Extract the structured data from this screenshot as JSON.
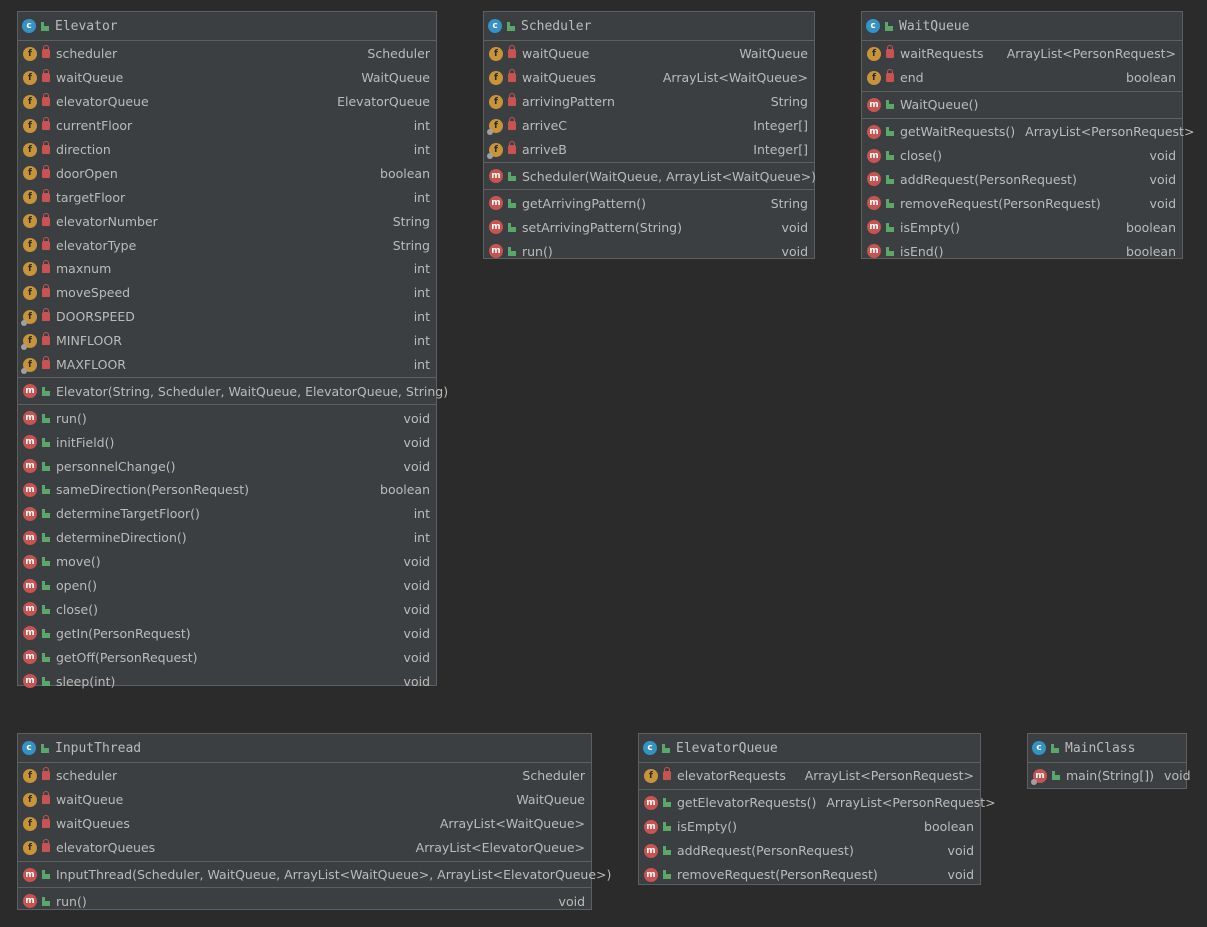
{
  "classes": {
    "elevator": {
      "name": "Elevator",
      "fields": [
        {
          "name": "scheduler",
          "type": "Scheduler",
          "static": false
        },
        {
          "name": "waitQueue",
          "type": "WaitQueue",
          "static": false
        },
        {
          "name": "elevatorQueue",
          "type": "ElevatorQueue",
          "static": false
        },
        {
          "name": "currentFloor",
          "type": "int",
          "static": false
        },
        {
          "name": "direction",
          "type": "int",
          "static": false
        },
        {
          "name": "doorOpen",
          "type": "boolean",
          "static": false
        },
        {
          "name": "targetFloor",
          "type": "int",
          "static": false
        },
        {
          "name": "elevatorNumber",
          "type": "String",
          "static": false
        },
        {
          "name": "elevatorType",
          "type": "String",
          "static": false
        },
        {
          "name": "maxnum",
          "type": "int",
          "static": false
        },
        {
          "name": "moveSpeed",
          "type": "int",
          "static": false
        },
        {
          "name": "DOORSPEED",
          "type": "int",
          "static": true
        },
        {
          "name": "MINFLOOR",
          "type": "int",
          "static": true
        },
        {
          "name": "MAXFLOOR",
          "type": "int",
          "static": true
        }
      ],
      "constructors": [
        {
          "name": "Elevator(String, Scheduler, WaitQueue, ElevatorQueue, String)",
          "type": ""
        }
      ],
      "methods": [
        {
          "name": "run()",
          "type": "void"
        },
        {
          "name": "initField()",
          "type": "void"
        },
        {
          "name": "personnelChange()",
          "type": "void"
        },
        {
          "name": "sameDirection(PersonRequest)",
          "type": "boolean"
        },
        {
          "name": "determineTargetFloor()",
          "type": "int"
        },
        {
          "name": "determineDirection()",
          "type": "int"
        },
        {
          "name": "move()",
          "type": "void"
        },
        {
          "name": "open()",
          "type": "void"
        },
        {
          "name": "close()",
          "type": "void"
        },
        {
          "name": "getIn(PersonRequest)",
          "type": "void"
        },
        {
          "name": "getOff(PersonRequest)",
          "type": "void"
        },
        {
          "name": "sleep(int)",
          "type": "void"
        }
      ]
    },
    "scheduler": {
      "name": "Scheduler",
      "fields": [
        {
          "name": "waitQueue",
          "type": "WaitQueue",
          "static": false
        },
        {
          "name": "waitQueues",
          "type": "ArrayList<WaitQueue>",
          "static": false
        },
        {
          "name": "arrivingPattern",
          "type": "String",
          "static": false
        },
        {
          "name": "arriveC",
          "type": "Integer[]",
          "static": true
        },
        {
          "name": "arriveB",
          "type": "Integer[]",
          "static": true
        }
      ],
      "constructors": [
        {
          "name": "Scheduler(WaitQueue, ArrayList<WaitQueue>)",
          "type": ""
        }
      ],
      "methods": [
        {
          "name": "getArrivingPattern()",
          "type": "String"
        },
        {
          "name": "setArrivingPattern(String)",
          "type": "void"
        },
        {
          "name": "run()",
          "type": "void"
        }
      ]
    },
    "waitqueue": {
      "name": "WaitQueue",
      "fields": [
        {
          "name": "waitRequests",
          "type": "ArrayList<PersonRequest>",
          "static": false
        },
        {
          "name": "end",
          "type": "boolean",
          "static": false
        }
      ],
      "constructors": [
        {
          "name": "WaitQueue()",
          "type": ""
        }
      ],
      "methods": [
        {
          "name": "getWaitRequests()",
          "type": "ArrayList<PersonRequest>"
        },
        {
          "name": "close()",
          "type": "void"
        },
        {
          "name": "addRequest(PersonRequest)",
          "type": "void"
        },
        {
          "name": "removeRequest(PersonRequest)",
          "type": "void"
        },
        {
          "name": "isEmpty()",
          "type": "boolean"
        },
        {
          "name": "isEnd()",
          "type": "boolean"
        }
      ]
    },
    "inputthread": {
      "name": "InputThread",
      "fields": [
        {
          "name": "scheduler",
          "type": "Scheduler",
          "static": false
        },
        {
          "name": "waitQueue",
          "type": "WaitQueue",
          "static": false
        },
        {
          "name": "waitQueues",
          "type": "ArrayList<WaitQueue>",
          "static": false
        },
        {
          "name": "elevatorQueues",
          "type": "ArrayList<ElevatorQueue>",
          "static": false
        }
      ],
      "constructors": [
        {
          "name": "InputThread(Scheduler, WaitQueue, ArrayList<WaitQueue>, ArrayList<ElevatorQueue>)",
          "type": ""
        }
      ],
      "methods": [
        {
          "name": "run()",
          "type": "void"
        }
      ]
    },
    "elevatorqueue": {
      "name": "ElevatorQueue",
      "fields": [
        {
          "name": "elevatorRequests",
          "type": "ArrayList<PersonRequest>",
          "static": false
        }
      ],
      "constructors": [],
      "methods": [
        {
          "name": "getElevatorRequests()",
          "type": "ArrayList<PersonRequest>"
        },
        {
          "name": "isEmpty()",
          "type": "boolean"
        },
        {
          "name": "addRequest(PersonRequest)",
          "type": "void"
        },
        {
          "name": "removeRequest(PersonRequest)",
          "type": "void"
        }
      ]
    },
    "mainclass": {
      "name": "MainClass",
      "fields": [],
      "constructors": [],
      "methods": [
        {
          "name": "main(String[])",
          "type": "void",
          "static": true
        }
      ]
    }
  }
}
